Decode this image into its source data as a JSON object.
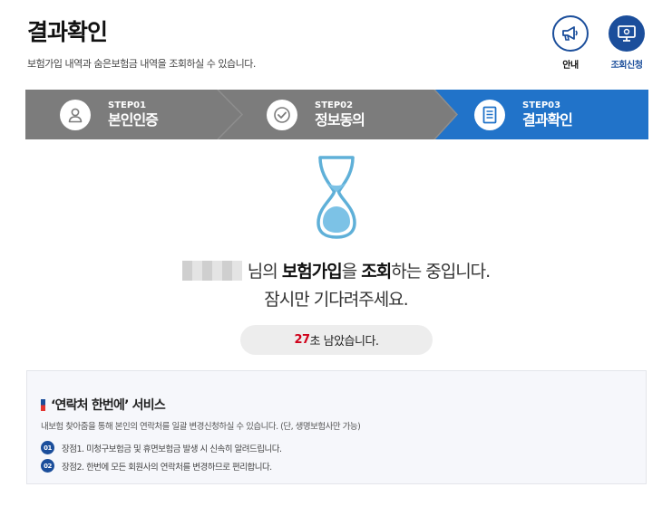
{
  "header": {
    "title": "결과확인",
    "subtitle": "보험가입 내역과 숨은보험금 내역을 조회하실 수 있습니다."
  },
  "top_buttons": {
    "guide_label": "안내",
    "apply_label": "조회신청"
  },
  "steps": [
    {
      "no": "STEP01",
      "name": "본인인증",
      "icon": "person-icon",
      "active": false
    },
    {
      "no": "STEP02",
      "name": "정보동의",
      "icon": "check-circle-icon",
      "active": false
    },
    {
      "no": "STEP03",
      "name": "결과확인",
      "icon": "document-icon",
      "active": true
    }
  ],
  "status": {
    "name_suffix": "님의",
    "keyword1": "보험가입",
    "particle1": "을",
    "keyword2": "조회",
    "rest": "하는 중입니다.",
    "line2": "잠시만 기다려주세요."
  },
  "timer": {
    "seconds": "27",
    "suffix": "초 남았습니다."
  },
  "service": {
    "title": "‘연락처 한번에’ 서비스",
    "description": "내보험 찾아줌을 통해 본인의 연락처를 일괄 변경신청하실 수 있습니다. (단, 생명보험사만 가능)",
    "items": [
      {
        "num": "01",
        "text": "장점1. 미청구보험금 및 휴면보험금 발생 시 신속히 알려드립니다."
      },
      {
        "num": "02",
        "text": "장점2. 한번에 모든 회원사의 연락처를 변경하므로 편리합니다."
      }
    ]
  },
  "colors": {
    "primary": "#1b4e9b",
    "step_active": "#2173c9",
    "step_inactive": "#7c7c7c",
    "hourglass_stroke": "#5fb0d8",
    "sand": "#7cc2e6",
    "timer_seconds": "#d0021b"
  }
}
